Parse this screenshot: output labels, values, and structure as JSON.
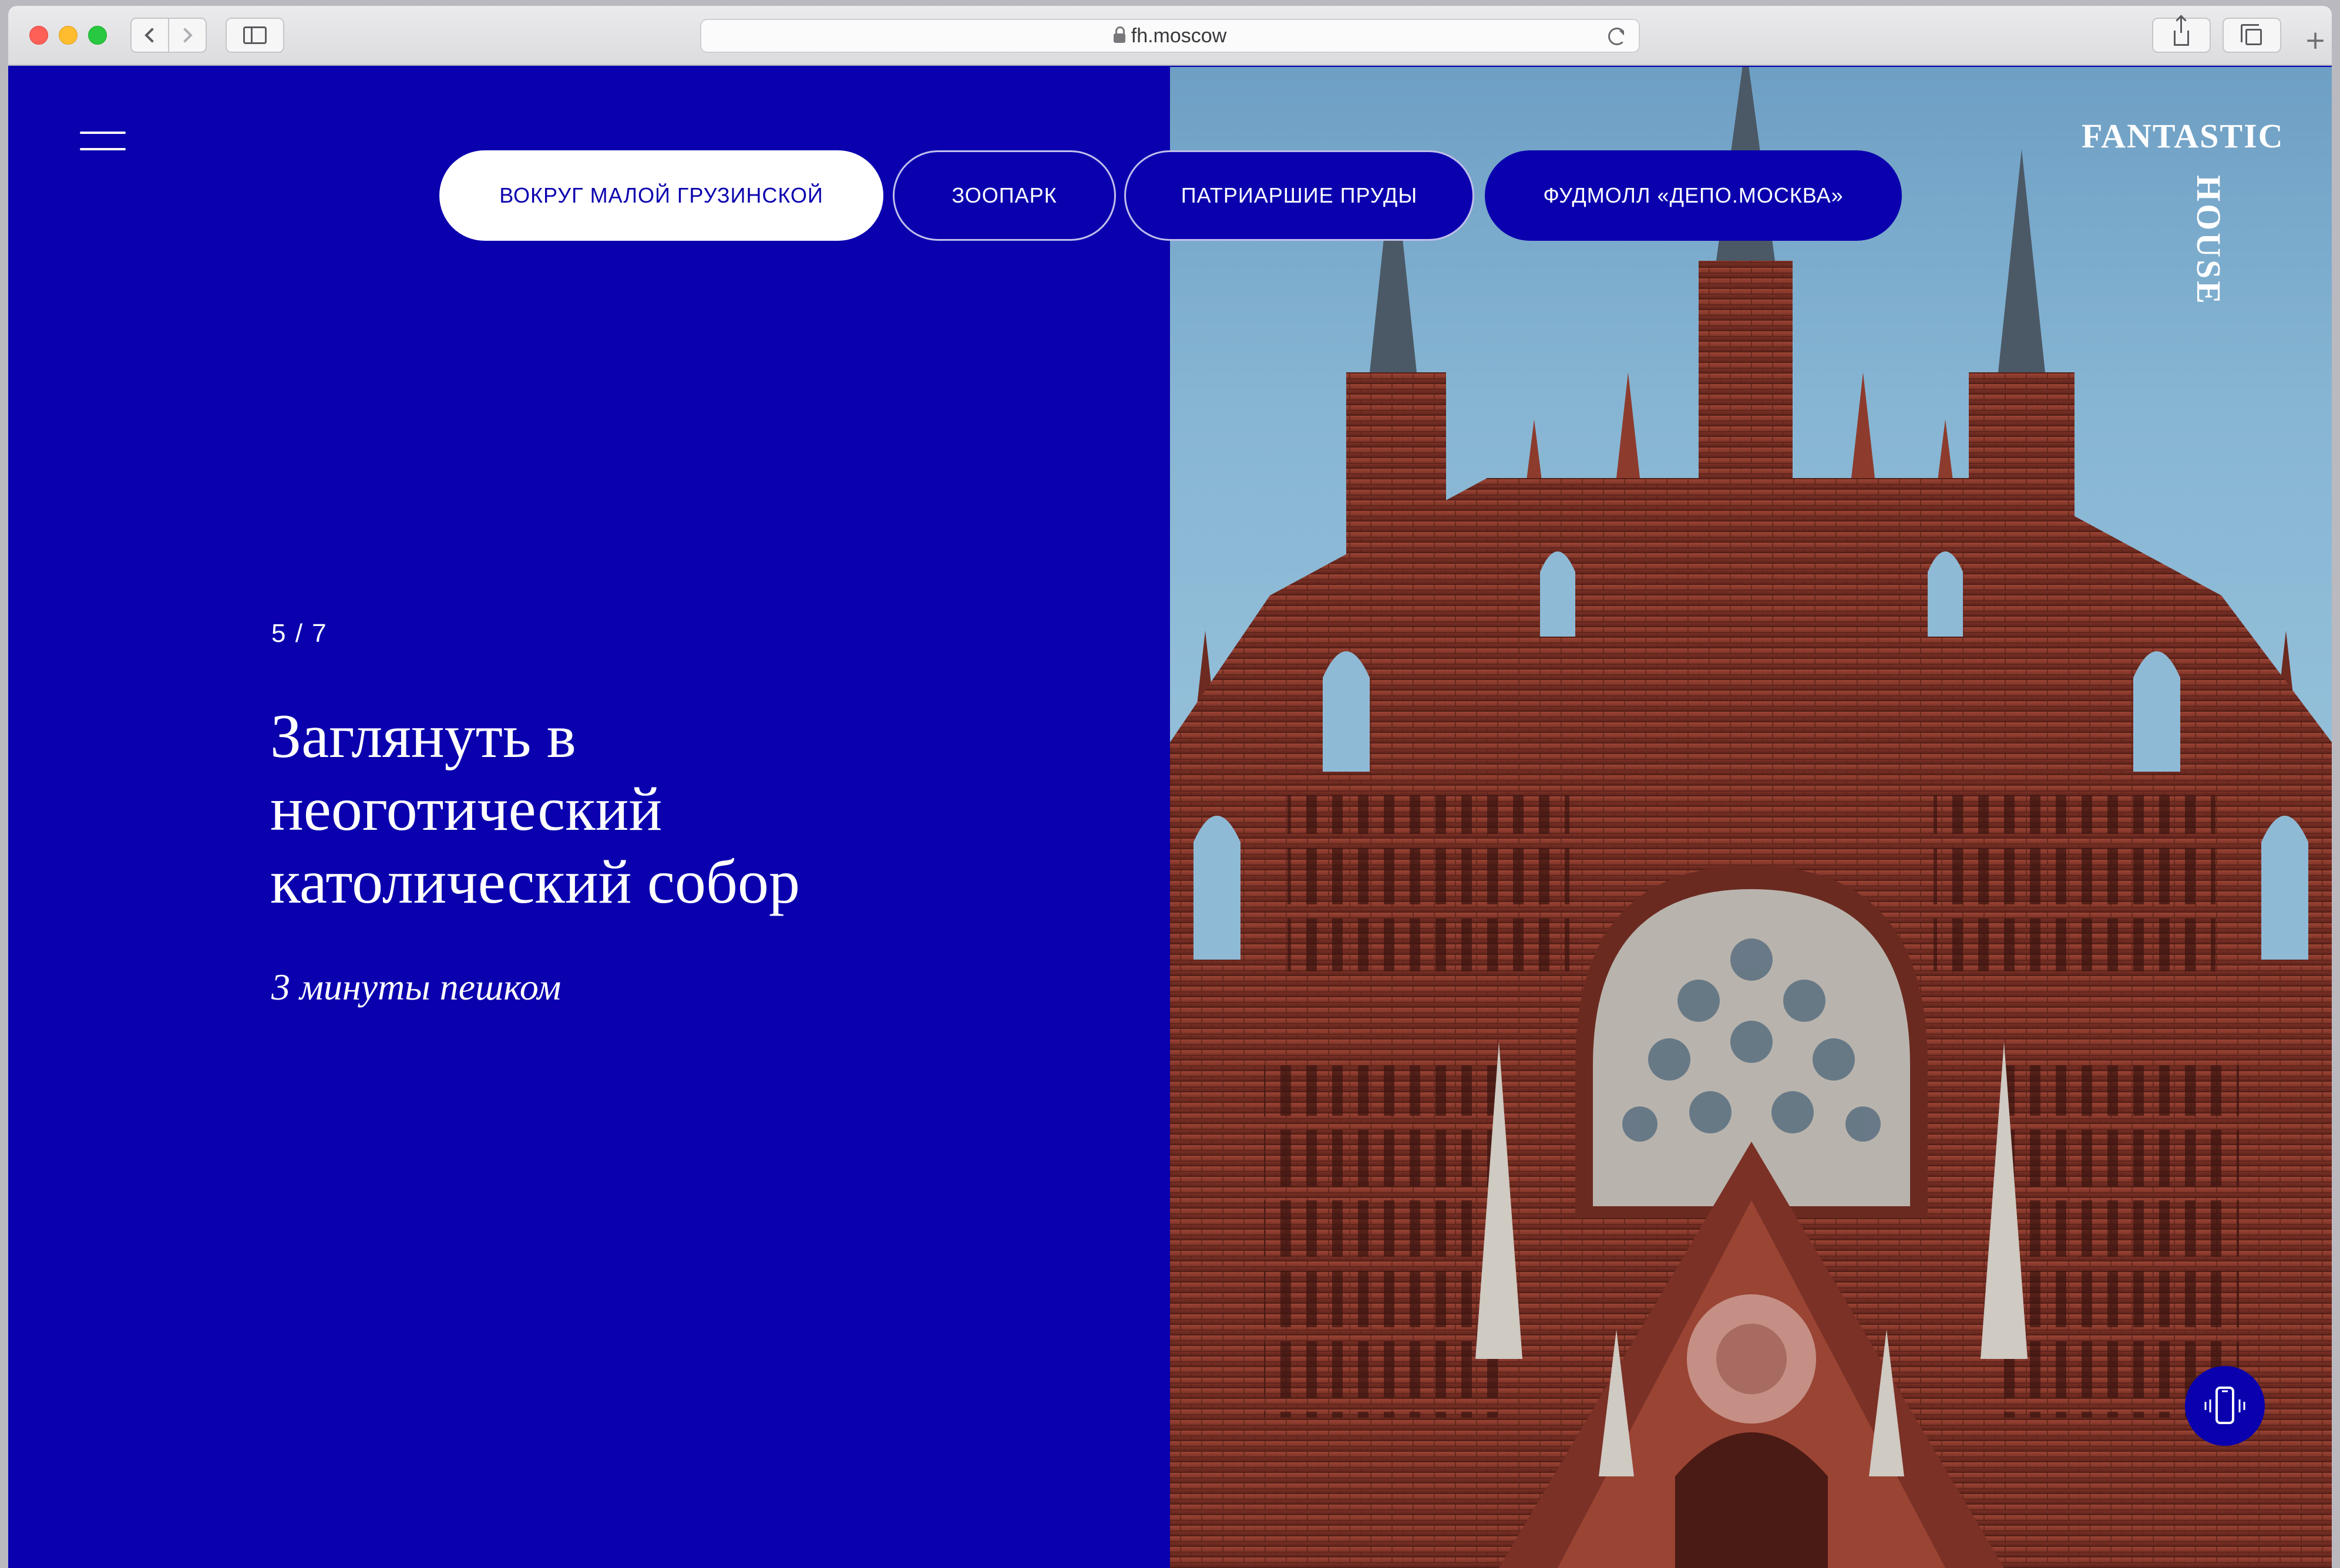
{
  "browser": {
    "url": "fh.moscow"
  },
  "page": {
    "nav": [
      {
        "label": "ВОКРУГ МАЛОЙ ГРУЗИНСКОЙ",
        "active": true
      },
      {
        "label": "ЗООПАРК",
        "active": false
      },
      {
        "label": "ПАТРИАРШИЕ ПРУДЫ",
        "active": false
      },
      {
        "label": "ФУДМОЛЛ «ДЕПО.МОСКВА»",
        "active": false
      }
    ],
    "counter": "5 / 7",
    "headline": "Заглянуть в неоготический католический собор",
    "subline": "3 минуты пешком",
    "logo": {
      "top": "FANTASTIC",
      "side": "HOUSE"
    }
  },
  "colors": {
    "brand_blue": "#0a00ae",
    "text_white": "#ffffff"
  },
  "icons": {
    "menu": "hamburger-icon",
    "phone": "phone-icon",
    "photo": "cathedral-photo"
  }
}
